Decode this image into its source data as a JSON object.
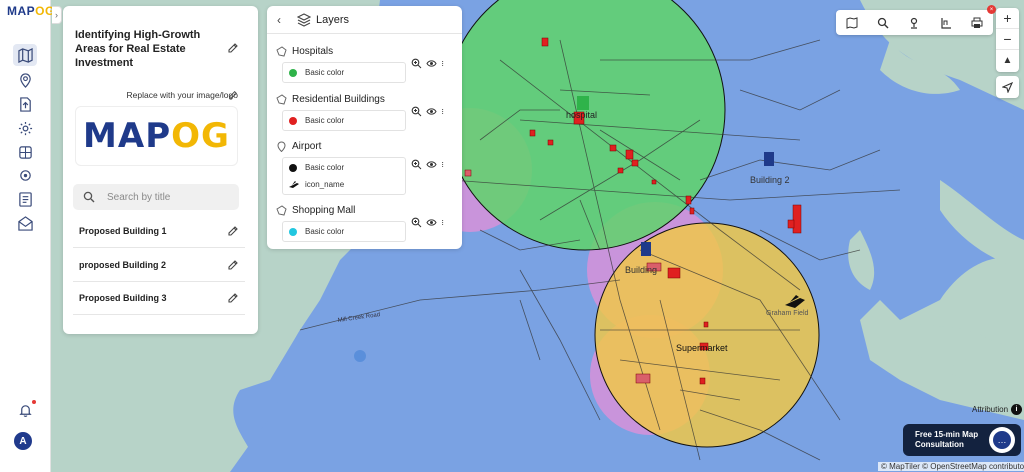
{
  "app": {
    "logo_text_a": "MAP",
    "logo_text_b": "OG"
  },
  "sidebar": {
    "icons": [
      "map-icon",
      "location-pin-icon",
      "upload-icon",
      "settings-icon",
      "layers-tool-icon",
      "gear-icon",
      "form-icon",
      "mail-icon"
    ],
    "user_initial": "A"
  },
  "project": {
    "title": "Identifying High-Growth Areas for Real Estate Investment",
    "replace_logo": "Replace with your image/logo",
    "logo_a": "MAP",
    "logo_b": "OG",
    "search_placeholder": "Search by title",
    "items": [
      "Proposed Building 1",
      "proposed Building 2",
      "Proposed Building 3"
    ]
  },
  "layers": {
    "title": "Layers",
    "list": [
      {
        "name": "Hospitals",
        "styles": [
          {
            "label": "Basic color",
            "color": "#2fb34a"
          }
        ]
      },
      {
        "name": "Residential Buildings",
        "styles": [
          {
            "label": "Basic color",
            "color": "#e02020"
          }
        ]
      },
      {
        "name": "Airport",
        "styles": [
          {
            "label": "Basic color",
            "color": "#111111"
          },
          {
            "label": "icon_name",
            "icon": "airplane-icon"
          }
        ]
      },
      {
        "name": "Shopping Mall",
        "styles": [
          {
            "label": "Basic color",
            "color": "#22c7e0"
          }
        ]
      }
    ]
  },
  "map": {
    "labels": {
      "hospital": "hospital",
      "building2": "Building 2",
      "building": "Building",
      "supermarket": "Supermarket",
      "airport": "Graham Field",
      "road": "Mill Creek Road"
    },
    "attribution": "Attribution",
    "footer": "© MapTiler © OpenStreetMap contributors"
  },
  "consult": {
    "line1": "Free 15-min Map",
    "line2": "Consultation"
  },
  "colors": {
    "water": "#7aa2e3",
    "land": "#b7d3c8",
    "hospital_buffer": "#5fd36a",
    "mall_buffer": "#f2c844",
    "residential_buffer": "#e48fd8"
  }
}
